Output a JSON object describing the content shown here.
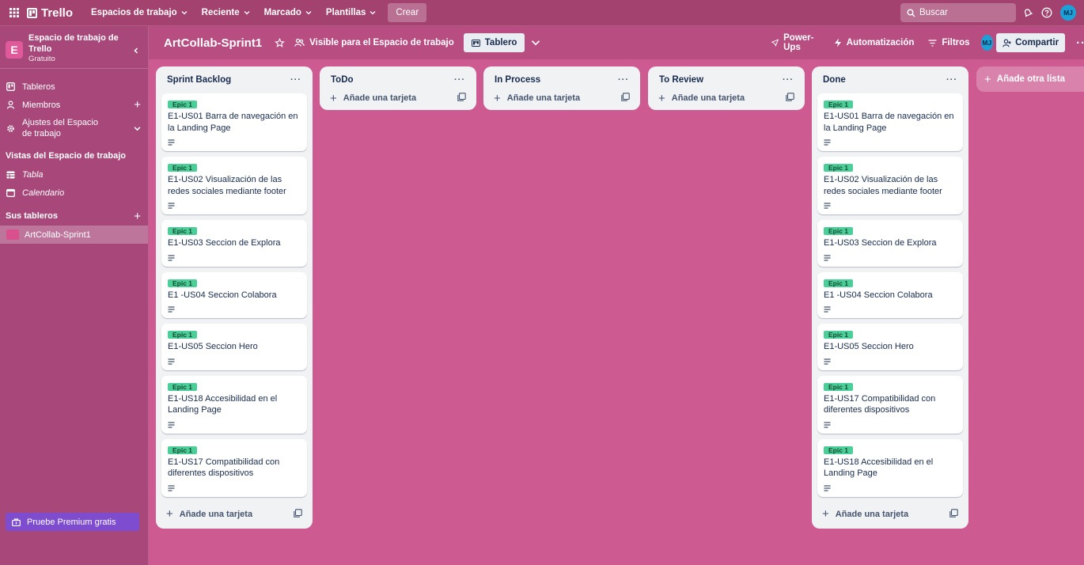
{
  "topnav": {
    "brand": "Trello",
    "menus": [
      "Espacios de trabajo",
      "Reciente",
      "Marcado",
      "Plantillas"
    ],
    "create": "Crear",
    "search_placeholder": "Buscar",
    "avatar": "MJ"
  },
  "sidebar": {
    "workspace_initial": "E",
    "workspace_name": "Espacio de trabajo de Trello",
    "workspace_plan": "Gratuito",
    "items": [
      {
        "label": "Tableros",
        "icon": "board-icon"
      },
      {
        "label": "Miembros",
        "icon": "person-icon"
      },
      {
        "label": "Ajustes del Espacio de trabajo",
        "icon": "gear-icon"
      }
    ],
    "views_title": "Vistas del Espacio de trabajo",
    "views": [
      "Tabla",
      "Calendario"
    ],
    "boards_title": "Sus tableros",
    "boards": [
      "ArtCollab-Sprint1"
    ],
    "premium": "Pruebe Premium gratis"
  },
  "board_header": {
    "title": "ArtCollab-Sprint1",
    "visibility": "Visible para el Espacio de trabajo",
    "view": "Tablero",
    "powerups": "Power-Ups",
    "automation": "Automatización",
    "filters": "Filtros",
    "avatar": "MJ",
    "share": "Compartir"
  },
  "lists": [
    {
      "title": "Sprint Backlog",
      "cards": [
        {
          "label": "Epic 1",
          "title": "E1-US01 Barra de navegación en la Landing Page"
        },
        {
          "label": "Epic 1",
          "title": "E1-US02 Visualización de las redes sociales mediante footer"
        },
        {
          "label": "Epic 1",
          "title": "E1-US03 Seccion de Explora"
        },
        {
          "label": "Epic 1",
          "title": "E1 -US04 Seccion Colabora"
        },
        {
          "label": "Epic 1",
          "title": "E1-US05 Seccion Hero"
        },
        {
          "label": "Epic 1",
          "title": "E1-US18 Accesibilidad en el Landing Page"
        },
        {
          "label": "Epic 1",
          "title": "E1-US17 Compatibilidad con diferentes dispositivos"
        }
      ],
      "add": "Añade una tarjeta"
    },
    {
      "title": "ToDo",
      "cards": [],
      "add": "Añade una tarjeta"
    },
    {
      "title": "In Process",
      "cards": [],
      "add": "Añade una tarjeta"
    },
    {
      "title": "To Review",
      "cards": [],
      "add": "Añade una tarjeta"
    },
    {
      "title": "Done",
      "cards": [
        {
          "label": "Epic 1",
          "title": "E1-US01 Barra de navegación en la Landing Page"
        },
        {
          "label": "Epic 1",
          "title": "E1-US02 Visualización de las redes sociales mediante footer"
        },
        {
          "label": "Epic 1",
          "title": "E1-US03 Seccion de Explora"
        },
        {
          "label": "Epic 1",
          "title": "E1 -US04 Seccion Colabora"
        },
        {
          "label": "Epic 1",
          "title": "E1-US05 Seccion Hero"
        },
        {
          "label": "Epic 1",
          "title": "E1-US17 Compatibilidad con diferentes dispositivos"
        },
        {
          "label": "Epic 1",
          "title": "E1-US18 Accesibilidad en el Landing Page"
        }
      ],
      "add": "Añade una tarjeta"
    }
  ],
  "add_list": "Añade otra lista",
  "colors": {
    "board_bg": "#cd5a91",
    "topbar": "#a3416f",
    "sidebar": "#a8477a",
    "label_green": "#4bce97",
    "premium": "#7d4ccf"
  }
}
